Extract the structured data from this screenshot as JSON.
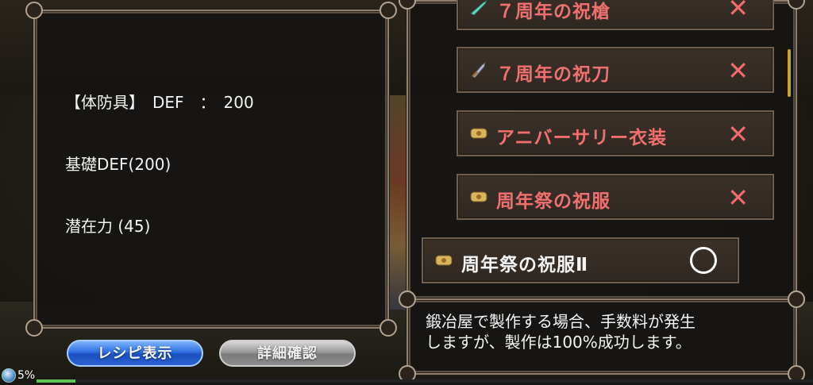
{
  "equipment": {
    "line1": "【体防具】　DEF　：　200",
    "line2": "基礎DEF(200)",
    "line3": "潜在力 (45)"
  },
  "buttons": {
    "recipe": "レシピ表示",
    "detail": "詳細確認"
  },
  "status": {
    "percent": "5%",
    "progress": 0.05
  },
  "recipe_list": [
    {
      "name": "７周年の祝槍",
      "state": "cross",
      "icon": "spear-icon"
    },
    {
      "name": "７周年の祝刀",
      "state": "cross",
      "icon": "sword-icon"
    },
    {
      "name": "アニバーサリー衣装",
      "state": "cross",
      "icon": "scroll-icon"
    },
    {
      "name": "周年祭の祝服",
      "state": "cross",
      "icon": "scroll-icon"
    },
    {
      "name": "周年祭の祝服Ⅱ",
      "state": "circle",
      "icon": "scroll-icon"
    }
  ],
  "marks": {
    "cross": "✕",
    "circle": ""
  },
  "message": "鍛冶屋で製作する場合、手数料が発生\nしますが、製作は100%成功します。",
  "colors": {
    "unavailable": "#f07070",
    "available": "#f4f4f4",
    "recipe_button": "#2f6fe0"
  }
}
